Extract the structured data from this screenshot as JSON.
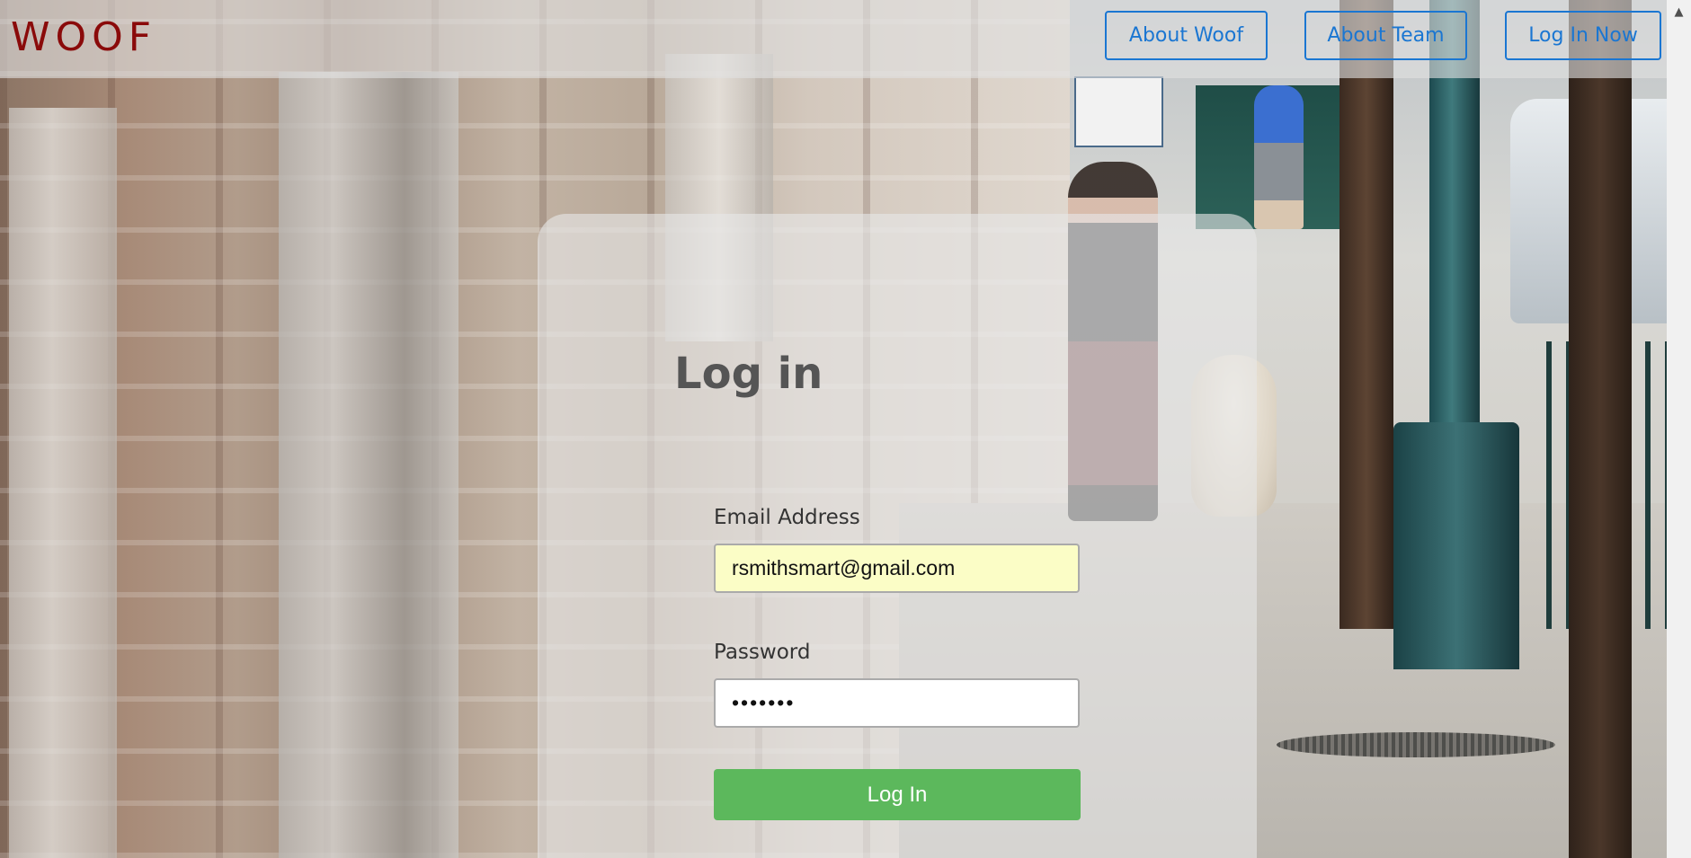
{
  "navbar": {
    "brand": "WOOF",
    "links": {
      "about_woof": "About Woof",
      "about_team": "About Team",
      "log_in_now": "Log In Now"
    }
  },
  "login": {
    "title": "Log in",
    "email": {
      "label": "Email Address",
      "value": "rsmithsmart@gmail.com"
    },
    "password": {
      "label": "Password",
      "value": "•••••••"
    },
    "submit_label": "Log In"
  },
  "colors": {
    "brand": "#8a0a0a",
    "nav_accent": "#1a76d2",
    "submit": "#5cb85c",
    "autofill": "#fbfdc6"
  },
  "icons": {
    "scroll_up": "triangle-up"
  }
}
